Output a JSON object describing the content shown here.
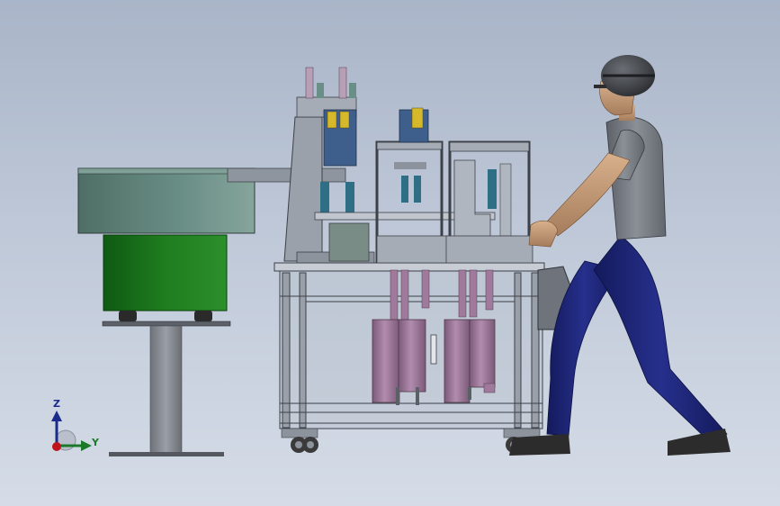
{
  "viewport": {
    "background_top": "#a9b5c8",
    "background_bottom": "#d5dce7"
  },
  "triad": {
    "z_label": "Z",
    "y_label": "Y",
    "z_color": "#1a2b8c",
    "y_color": "#1b7a2a",
    "x_color": "#c0141c"
  },
  "colors": {
    "feeder_hopper": "#6a8f86",
    "feeder_base": "#1f7d1f",
    "frame_steel": "#8c929e",
    "cylinder": "#a07a9c",
    "worker_shirt": "#7b7f86",
    "worker_pants": "#1d2373",
    "worker_skin": "#c59c78"
  }
}
